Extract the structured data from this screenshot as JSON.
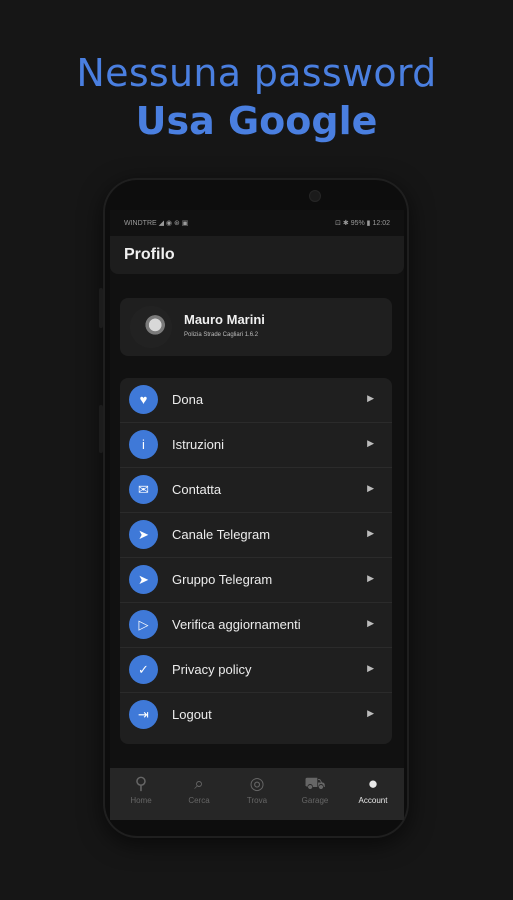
{
  "headline": {
    "line1": "Nessuna password",
    "line2": "Usa Google"
  },
  "status_bar": {
    "carrier": "WINDTRE ◢ ◉ ⊛ ▣",
    "right": "⊡ ✱ 95% ▮ 12:02"
  },
  "header": {
    "title": "Profilo"
  },
  "profile": {
    "name": "Mauro Marini",
    "subtitle": "Polizia Strade Cagliari 1.6.2"
  },
  "menu": [
    {
      "label": "Dona",
      "icon": "heart-icon",
      "glyph": "♥"
    },
    {
      "label": "Istruzioni",
      "icon": "info-icon",
      "glyph": "i"
    },
    {
      "label": "Contatta",
      "icon": "mail-icon",
      "glyph": "✉"
    },
    {
      "label": "Canale Telegram",
      "icon": "telegram-icon",
      "glyph": "➤"
    },
    {
      "label": "Gruppo Telegram",
      "icon": "telegram-icon",
      "glyph": "➤"
    },
    {
      "label": "Verifica aggiornamenti",
      "icon": "play-store-icon",
      "glyph": "▷"
    },
    {
      "label": "Privacy policy",
      "icon": "shield-check-icon",
      "glyph": "✓"
    },
    {
      "label": "Logout",
      "icon": "logout-icon",
      "glyph": "⇥"
    }
  ],
  "tabs": [
    {
      "label": "Home",
      "icon": "location-pin-icon",
      "glyph": "⚲"
    },
    {
      "label": "Cerca",
      "icon": "search-icon",
      "glyph": "⌕"
    },
    {
      "label": "Trova",
      "icon": "compass-icon",
      "glyph": "◎"
    },
    {
      "label": "Garage",
      "icon": "car-icon",
      "glyph": "⛟"
    },
    {
      "label": "Account",
      "icon": "person-icon",
      "glyph": "●"
    }
  ],
  "active_tab": "Account",
  "colors": {
    "accent": "#4a7fe0",
    "icon_bg": "#3f79d8",
    "background": "#161616"
  }
}
